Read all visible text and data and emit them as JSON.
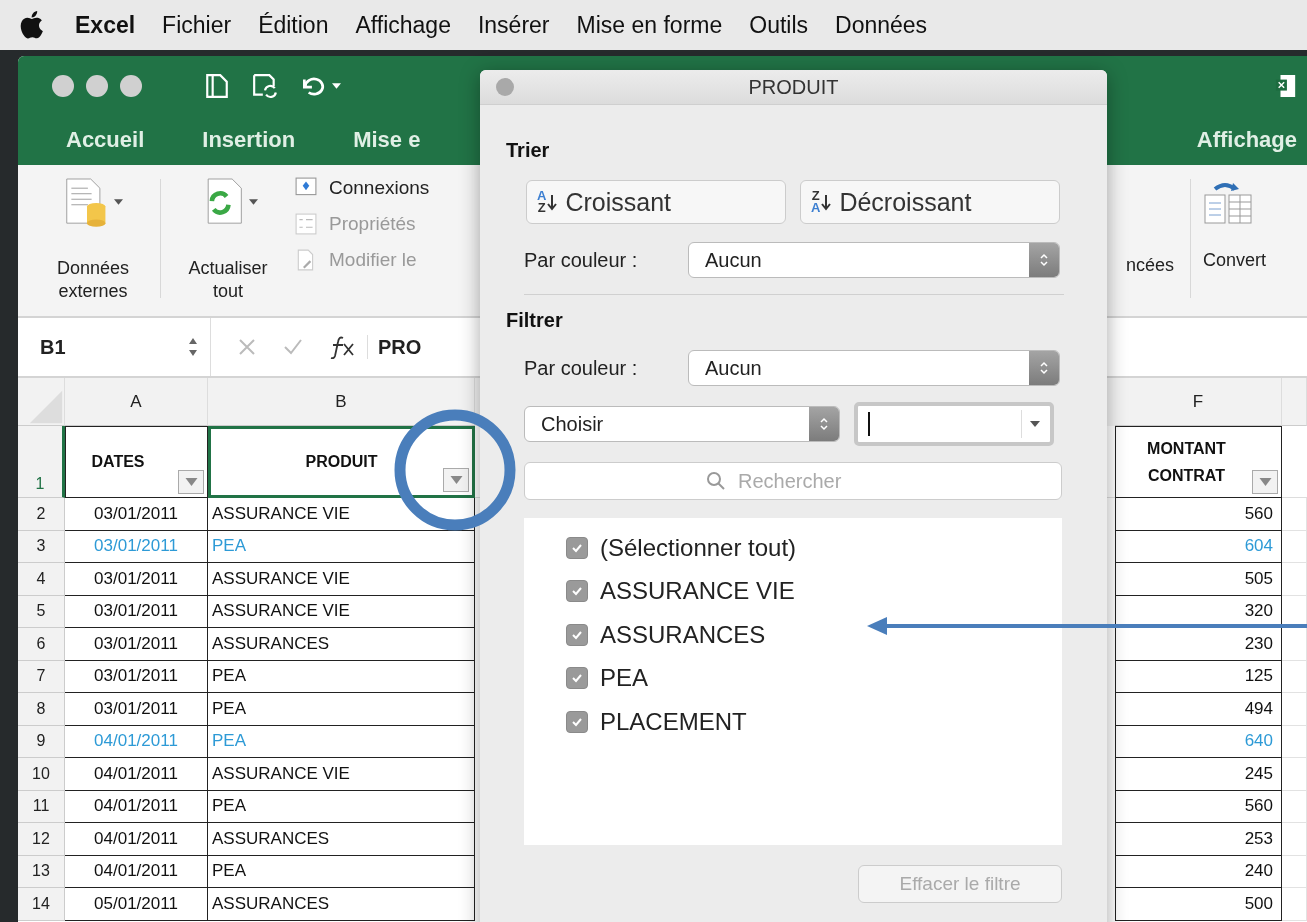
{
  "menu_bar": {
    "app": "Excel",
    "items": [
      "Fichier",
      "Édition",
      "Affichage",
      "Insérer",
      "Mise en forme",
      "Outils",
      "Données"
    ]
  },
  "ribbon_tabs": [
    "Accueil",
    "Insertion",
    "Mise e",
    "Affichage"
  ],
  "ribbon": {
    "external_data": "Données externes",
    "refresh_all": "Actualiser tout",
    "connections": "Connexions",
    "properties": "Propriétés",
    "edit_links": "Modifier le",
    "advanced": "ncées",
    "convert": "Convert"
  },
  "formula_bar": {
    "name_box": "B1",
    "content": "PRO"
  },
  "columns": [
    "A",
    "B",
    "F"
  ],
  "header_row": {
    "number": "1",
    "cells": [
      {
        "text": "DATES",
        "selected": false
      },
      {
        "text": "PRODUIT",
        "selected": true
      },
      {
        "text": "MONTANT CONTRAT",
        "selected": false
      }
    ]
  },
  "rows": [
    {
      "number": "2",
      "date": "03/01/2011",
      "product": "ASSURANCE VIE",
      "amount": "560",
      "highlighted": false
    },
    {
      "number": "3",
      "date": "03/01/2011",
      "product": "PEA",
      "amount": "604",
      "highlighted": true
    },
    {
      "number": "4",
      "date": "03/01/2011",
      "product": "ASSURANCE VIE",
      "amount": "505",
      "highlighted": false
    },
    {
      "number": "5",
      "date": "03/01/2011",
      "product": "ASSURANCE VIE",
      "amount": "320",
      "highlighted": false
    },
    {
      "number": "6",
      "date": "03/01/2011",
      "product": "ASSURANCES",
      "amount": "230",
      "highlighted": false
    },
    {
      "number": "7",
      "date": "03/01/2011",
      "product": "PEA",
      "amount": "125",
      "highlighted": false
    },
    {
      "number": "8",
      "date": "03/01/2011",
      "product": "PEA",
      "amount": "494",
      "highlighted": false
    },
    {
      "number": "9",
      "date": "04/01/2011",
      "product": "PEA",
      "amount": "640",
      "highlighted": true
    },
    {
      "number": "10",
      "date": "04/01/2011",
      "product": "ASSURANCE VIE",
      "amount": "245",
      "highlighted": false
    },
    {
      "number": "11",
      "date": "04/01/2011",
      "product": "PEA",
      "amount": "560",
      "highlighted": false
    },
    {
      "number": "12",
      "date": "04/01/2011",
      "product": "ASSURANCES",
      "amount": "253",
      "highlighted": false
    },
    {
      "number": "13",
      "date": "04/01/2011",
      "product": "PEA",
      "amount": "240",
      "highlighted": false
    },
    {
      "number": "14",
      "date": "05/01/2011",
      "product": "ASSURANCES",
      "amount": "500",
      "highlighted": false
    }
  ],
  "dialog": {
    "title": "PRODUIT",
    "sort": {
      "label": "Trier",
      "ascending": "Croissant",
      "ascending_icon": [
        "A",
        "Z"
      ],
      "descending": "Décroissant",
      "descending_icon": [
        "Z",
        "A"
      ],
      "color_label": "Par couleur :",
      "color_value": "Aucun"
    },
    "filter": {
      "label": "Filtrer",
      "color_label": "Par couleur :",
      "color_value": "Aucun",
      "condition": "Choisir",
      "search_placeholder": "Rechercher",
      "items": [
        {
          "label": "(Sélectionner tout)",
          "checked": true
        },
        {
          "label": "ASSURANCE VIE",
          "checked": true
        },
        {
          "label": "ASSURANCES",
          "checked": true
        },
        {
          "label": "PEA",
          "checked": true
        },
        {
          "label": "PLACEMENT",
          "checked": true
        }
      ],
      "clear_button": {
        "label": "Effacer le filtre",
        "disabled": true
      }
    }
  }
}
